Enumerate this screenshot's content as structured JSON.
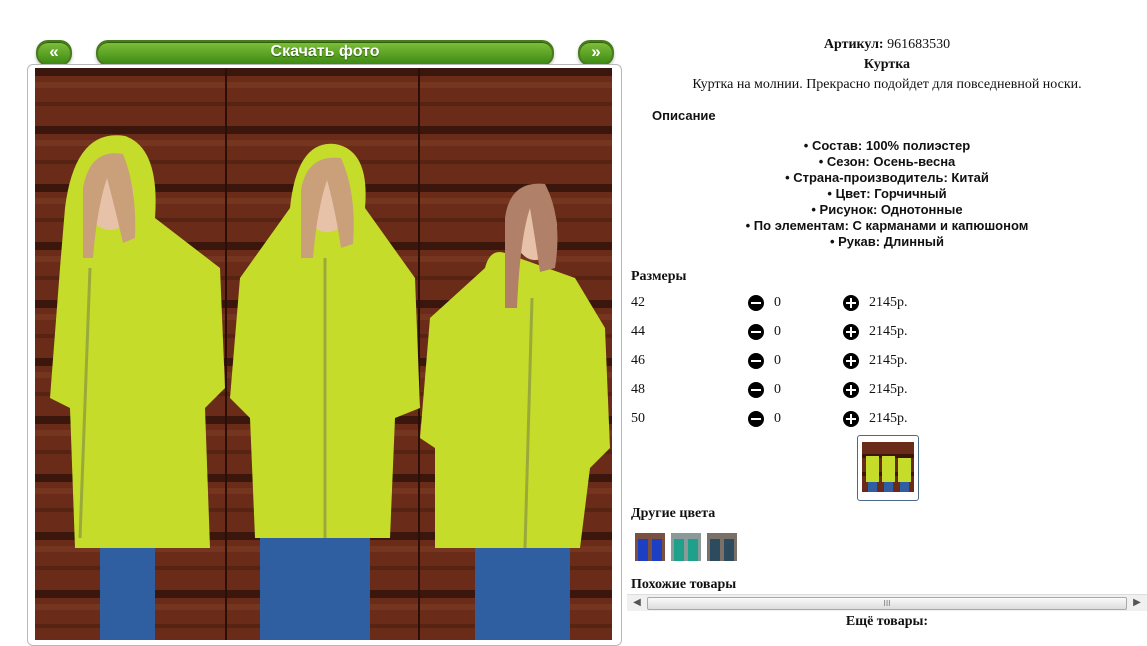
{
  "gallery": {
    "prev_label": "«",
    "download_label": "Скачать фото",
    "next_label": "»"
  },
  "product": {
    "sku_label": "Артикул:",
    "sku_value": "961683530",
    "title": "Куртка",
    "short_description": "Куртка на молнии. Прекрасно подойдет для повседневной носки.",
    "description_heading": "Описание",
    "specs": [
      "• Состав: 100% полиэстер",
      "• Сезон: Осень-весна",
      "• Страна-производитель: Китай",
      "• Цвет: Горчичный",
      "• Рисунок: Однотонные",
      "• По элементам: С карманами и капюшоном",
      "• Рукав: Длинный"
    ]
  },
  "sizes": {
    "heading": "Размеры",
    "rows": [
      {
        "size": "42",
        "qty": "0",
        "price": "2145р."
      },
      {
        "size": "44",
        "qty": "0",
        "price": "2145р."
      },
      {
        "size": "46",
        "qty": "0",
        "price": "2145р."
      },
      {
        "size": "48",
        "qty": "0",
        "price": "2145р."
      },
      {
        "size": "50",
        "qty": "0",
        "price": "2145р."
      }
    ]
  },
  "other_colors": {
    "heading": "Другие цвета",
    "swatches": [
      "#1c3fc4",
      "#1fa08a",
      "#2d4b5e"
    ]
  },
  "similar": {
    "heading": "Похожие товары",
    "scroll_left": "◀",
    "scroll_grip": "III",
    "scroll_right": "▶"
  },
  "more_label": "Ещё товары:",
  "colors": {
    "button_green": "#5aa526",
    "jacket": "#c6dc2a",
    "wood": "#5a2414"
  }
}
